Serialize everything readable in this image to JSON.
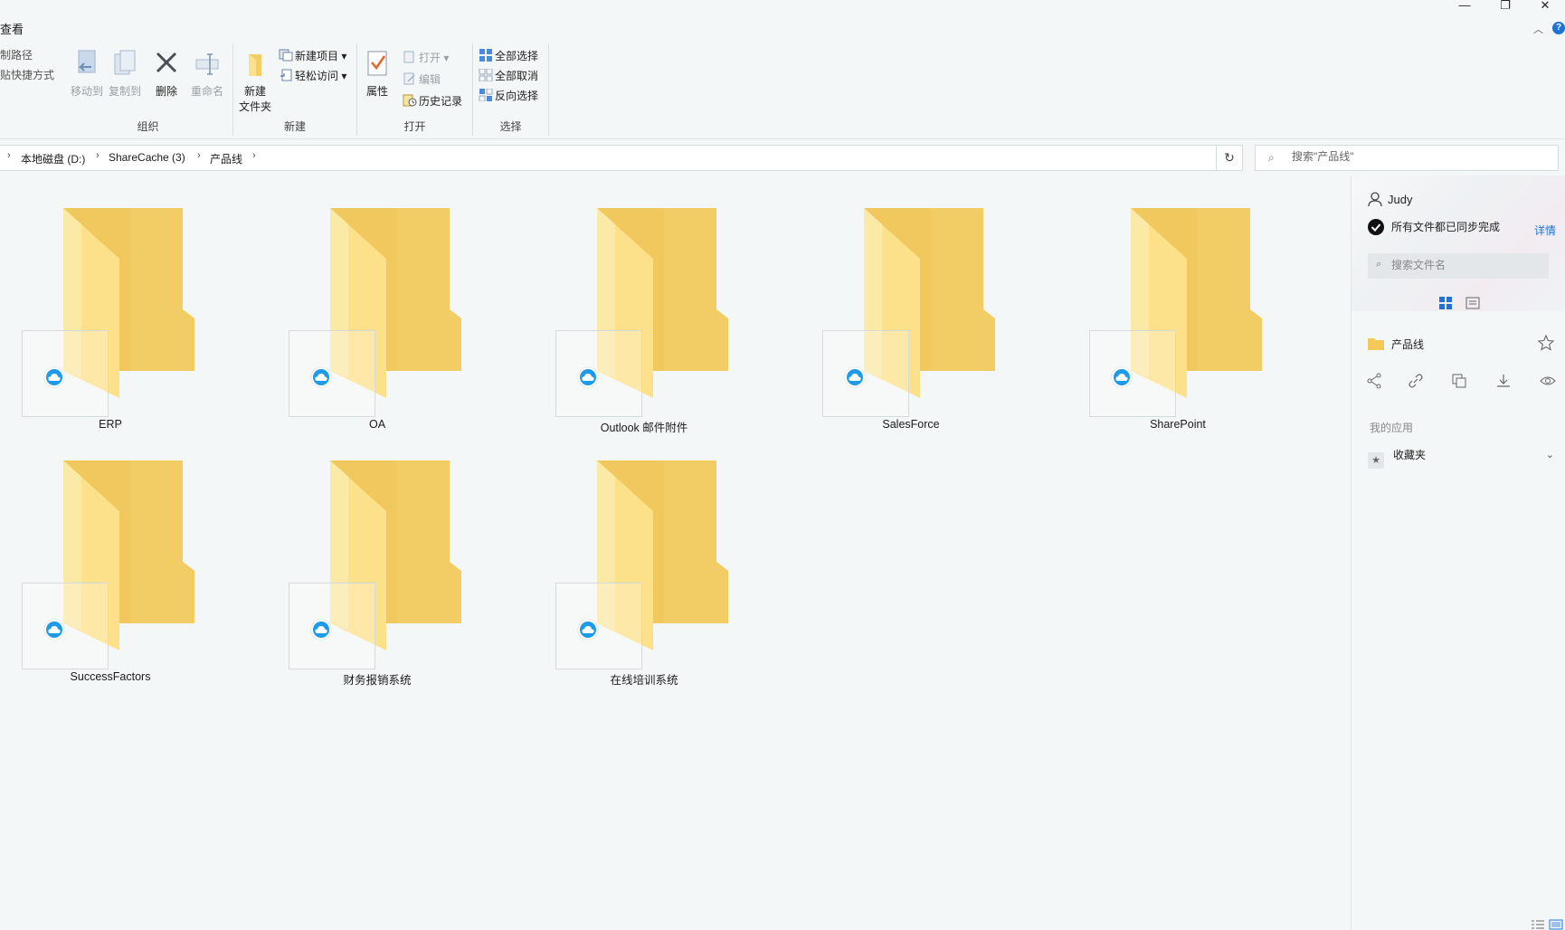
{
  "window": {
    "title_fragment": "查看",
    "minimize": "—",
    "restore": "❐",
    "close": "✕",
    "help": "?"
  },
  "ribbon": {
    "clipboard_fragments": [
      "制路径",
      "贴快捷方式"
    ],
    "organize": {
      "label": "组织",
      "move_to": "移动到",
      "copy_to": "复制到",
      "delete": "删除",
      "rename": "重命名"
    },
    "new": {
      "label": "新建",
      "new_folder_line1": "新建",
      "new_folder_line2": "文件夹",
      "new_item": "新建项目",
      "easy_access": "轻松访问"
    },
    "open": {
      "label": "打开",
      "properties": "属性",
      "open": "打开",
      "edit": "编辑",
      "history": "历史记录"
    },
    "select": {
      "label": "选择",
      "select_all": "全部选择",
      "select_none": "全部取消",
      "invert": "反向选择"
    }
  },
  "address": {
    "crumbs": [
      "本地磁盘 (D:)",
      "ShareCache (3)",
      "产品线"
    ],
    "search_placeholder": "搜索\"产品线\""
  },
  "folders": [
    {
      "name": "ERP"
    },
    {
      "name": "OA"
    },
    {
      "name": "Outlook 邮件附件"
    },
    {
      "name": "SalesForce"
    },
    {
      "name": "SharePoint"
    },
    {
      "name": "SuccessFactors"
    },
    {
      "name": "财务报销系统"
    },
    {
      "name": "在线培训系统"
    }
  ],
  "panel": {
    "user": "Judy",
    "sync_status": "所有文件都已同步完成",
    "detail_link": "详情",
    "search_placeholder": "搜索文件名",
    "current_folder": "产品线",
    "section_label": "我的应用",
    "favorites": "收藏夹"
  },
  "colors": {
    "folder_back": "#f0c85e",
    "folder_front": "#fbd972",
    "cloud_badge": "#1e9ae8",
    "accent": "#1e73d8"
  }
}
